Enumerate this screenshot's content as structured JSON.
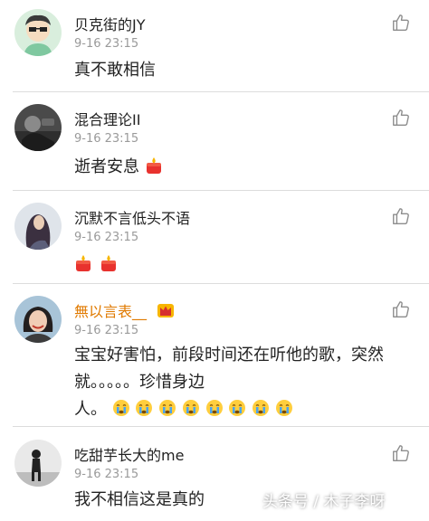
{
  "comments": [
    {
      "username": "贝克街的JY",
      "time": "9-16 23:15",
      "text": "真不敢相信"
    },
    {
      "username": "混合理论II",
      "time": "9-16 23:15",
      "text": "逝者安息"
    },
    {
      "username": "沉默不言低头不语",
      "time": "9-16 23:15",
      "text": ""
    },
    {
      "username": "無以言表__",
      "time": "9-16 23:15",
      "text_line1": "宝宝好害怕，前段时间还在听他的歌，突然",
      "text_line2": "就。。。。。珍惜身边",
      "text_line3": "人。"
    },
    {
      "username": "吃甜芋长大的me",
      "time": "9-16 23:15",
      "text": "我不相信这是真的"
    }
  ],
  "watermark": "头条号 / 木子李呀",
  "colors": {
    "vip_name": "#e07a00",
    "timestamp": "#9a9a9a",
    "divider": "#dcdcdc"
  },
  "icons": {
    "like": "thumbs-up-outline-icon",
    "candle": "candle-emoji-icon",
    "crying": "crying-face-emoji-icon",
    "crown": "vip-crown-icon"
  }
}
